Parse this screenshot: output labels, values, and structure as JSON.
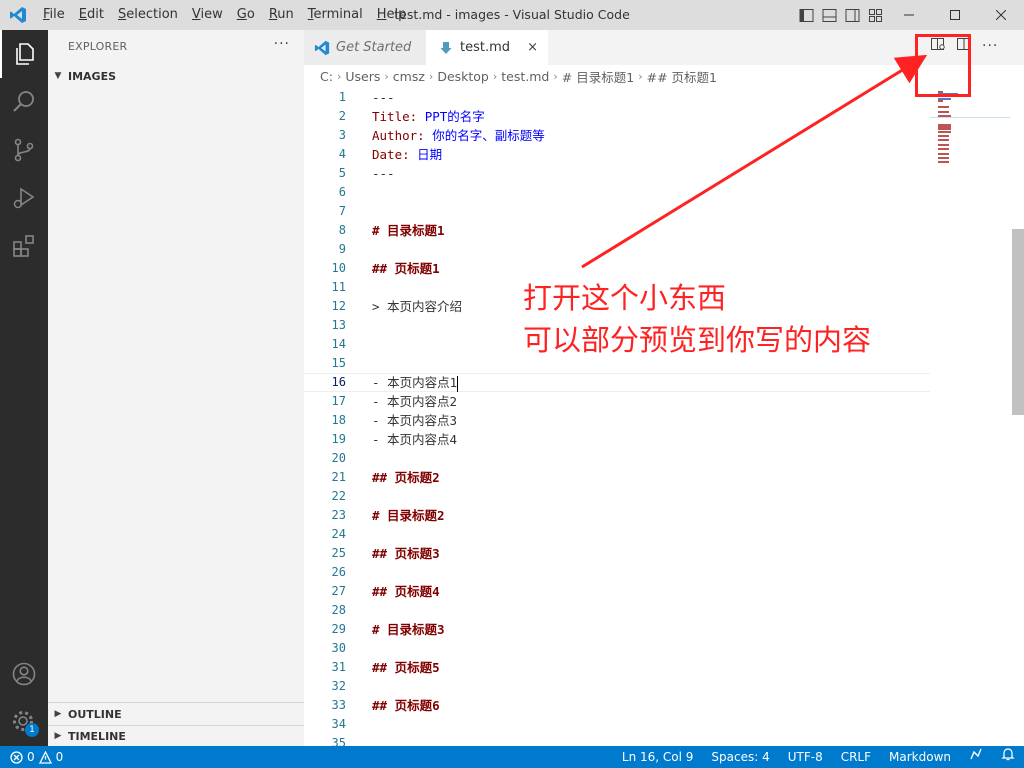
{
  "window": {
    "title": "test.md - images - Visual Studio Code",
    "menu": [
      {
        "u": "F",
        "rest": "ile"
      },
      {
        "u": "E",
        "rest": "dit"
      },
      {
        "u": "S",
        "rest": "election"
      },
      {
        "u": "V",
        "rest": "iew"
      },
      {
        "u": "G",
        "rest": "o"
      },
      {
        "u": "R",
        "rest": "un"
      },
      {
        "u": "T",
        "rest": "erminal"
      },
      {
        "u": "H",
        "rest": "elp"
      }
    ]
  },
  "activity": {
    "badge": "1"
  },
  "sidebar": {
    "header": "EXPLORER",
    "more": "···",
    "folder": "IMAGES",
    "outline": "OUTLINE",
    "timeline": "TIMELINE"
  },
  "tabs": {
    "inactive_label": "Get Started",
    "active_label": "test.md",
    "close": "×",
    "more": "···"
  },
  "breadcrumb": [
    "C:",
    "Users",
    "cmsz",
    "Desktop",
    "test.md",
    "# 目录标题1",
    "## 页标题1"
  ],
  "editor": {
    "current_line": 16,
    "lines": [
      {
        "n": "1",
        "parts": [
          {
            "t": "---",
            "c": "default"
          }
        ]
      },
      {
        "n": "2",
        "parts": [
          {
            "t": "Title: ",
            "c": "meta"
          },
          {
            "t": "PPT的名字",
            "c": "val"
          }
        ]
      },
      {
        "n": "3",
        "parts": [
          {
            "t": "Author: ",
            "c": "meta"
          },
          {
            "t": "你的名字、副标题等",
            "c": "val"
          }
        ]
      },
      {
        "n": "4",
        "parts": [
          {
            "t": "Date: ",
            "c": "meta"
          },
          {
            "t": "日期",
            "c": "val"
          }
        ]
      },
      {
        "n": "5",
        "parts": [
          {
            "t": "---",
            "c": "default"
          }
        ]
      },
      {
        "n": "6",
        "parts": []
      },
      {
        "n": "7",
        "parts": []
      },
      {
        "n": "8",
        "parts": [
          {
            "t": "# 目录标题1",
            "c": "head"
          }
        ]
      },
      {
        "n": "9",
        "parts": []
      },
      {
        "n": "10",
        "parts": [
          {
            "t": "## 页标题1",
            "c": "head"
          }
        ]
      },
      {
        "n": "11",
        "parts": []
      },
      {
        "n": "12",
        "parts": [
          {
            "t": "> 本页内容介绍",
            "c": "default"
          }
        ]
      },
      {
        "n": "13",
        "parts": []
      },
      {
        "n": "14",
        "parts": []
      },
      {
        "n": "15",
        "parts": []
      },
      {
        "n": "16",
        "parts": [
          {
            "t": "- ",
            "c": "default"
          },
          {
            "t": "本页内容点1",
            "c": "sel"
          }
        ]
      },
      {
        "n": "17",
        "parts": [
          {
            "t": "- 本页内容点2",
            "c": "default"
          }
        ]
      },
      {
        "n": "18",
        "parts": [
          {
            "t": "- 本页内容点3",
            "c": "default"
          }
        ]
      },
      {
        "n": "19",
        "parts": [
          {
            "t": "- 本页内容点4",
            "c": "default"
          }
        ]
      },
      {
        "n": "20",
        "parts": []
      },
      {
        "n": "21",
        "parts": [
          {
            "t": "## 页标题2",
            "c": "head"
          }
        ]
      },
      {
        "n": "22",
        "parts": []
      },
      {
        "n": "23",
        "parts": [
          {
            "t": "# 目录标题2",
            "c": "head"
          }
        ]
      },
      {
        "n": "24",
        "parts": []
      },
      {
        "n": "25",
        "parts": [
          {
            "t": "## 页标题3",
            "c": "head"
          }
        ]
      },
      {
        "n": "26",
        "parts": []
      },
      {
        "n": "27",
        "parts": [
          {
            "t": "## 页标题4",
            "c": "head"
          }
        ]
      },
      {
        "n": "28",
        "parts": []
      },
      {
        "n": "29",
        "parts": [
          {
            "t": "# 目录标题3",
            "c": "head"
          }
        ]
      },
      {
        "n": "30",
        "parts": []
      },
      {
        "n": "31",
        "parts": [
          {
            "t": "## 页标题5",
            "c": "head"
          }
        ]
      },
      {
        "n": "32",
        "parts": []
      },
      {
        "n": "33",
        "parts": [
          {
            "t": "## 页标题6",
            "c": "head"
          }
        ]
      },
      {
        "n": "34",
        "parts": []
      },
      {
        "n": "35",
        "parts": []
      }
    ]
  },
  "annotation": {
    "line1": "打开这个小东西",
    "line2": "可以部分预览到你写的内容",
    "color": "#ff2222"
  },
  "status": {
    "errors": "0",
    "warnings": "0",
    "position": "Ln 16, Col 9",
    "spaces": "Spaces: 4",
    "encoding": "UTF-8",
    "eol": "CRLF",
    "language": "Markdown"
  }
}
